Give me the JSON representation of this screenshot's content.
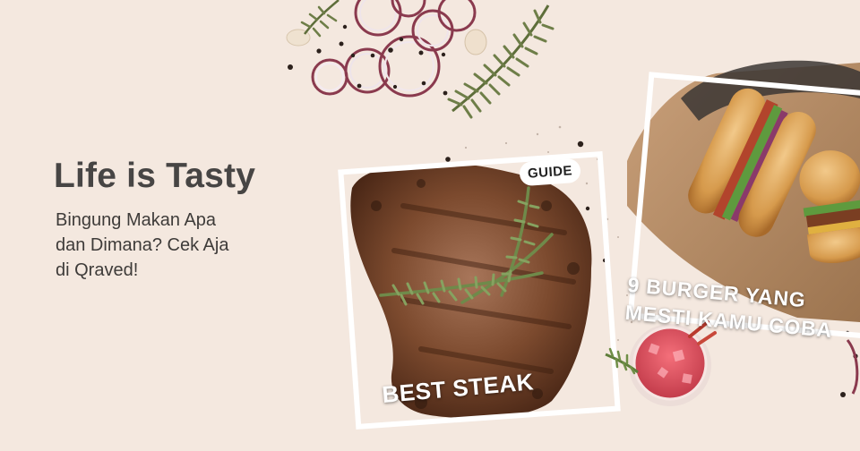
{
  "hero": {
    "headline": "Life is Tasty",
    "subline": [
      "Bingung Makan Apa",
      "dan Dimana? Cek Aja",
      "di Qraved!"
    ]
  },
  "cards": {
    "steak": {
      "tag": "GUIDE",
      "label": "BEST STEAK"
    },
    "burger": {
      "label_lines": [
        "9 BURGER YANG",
        "MESTI KAMU COBA"
      ]
    }
  },
  "colors": {
    "background": "#f4e8df",
    "headline": "#474544",
    "label": "#ffffff"
  }
}
